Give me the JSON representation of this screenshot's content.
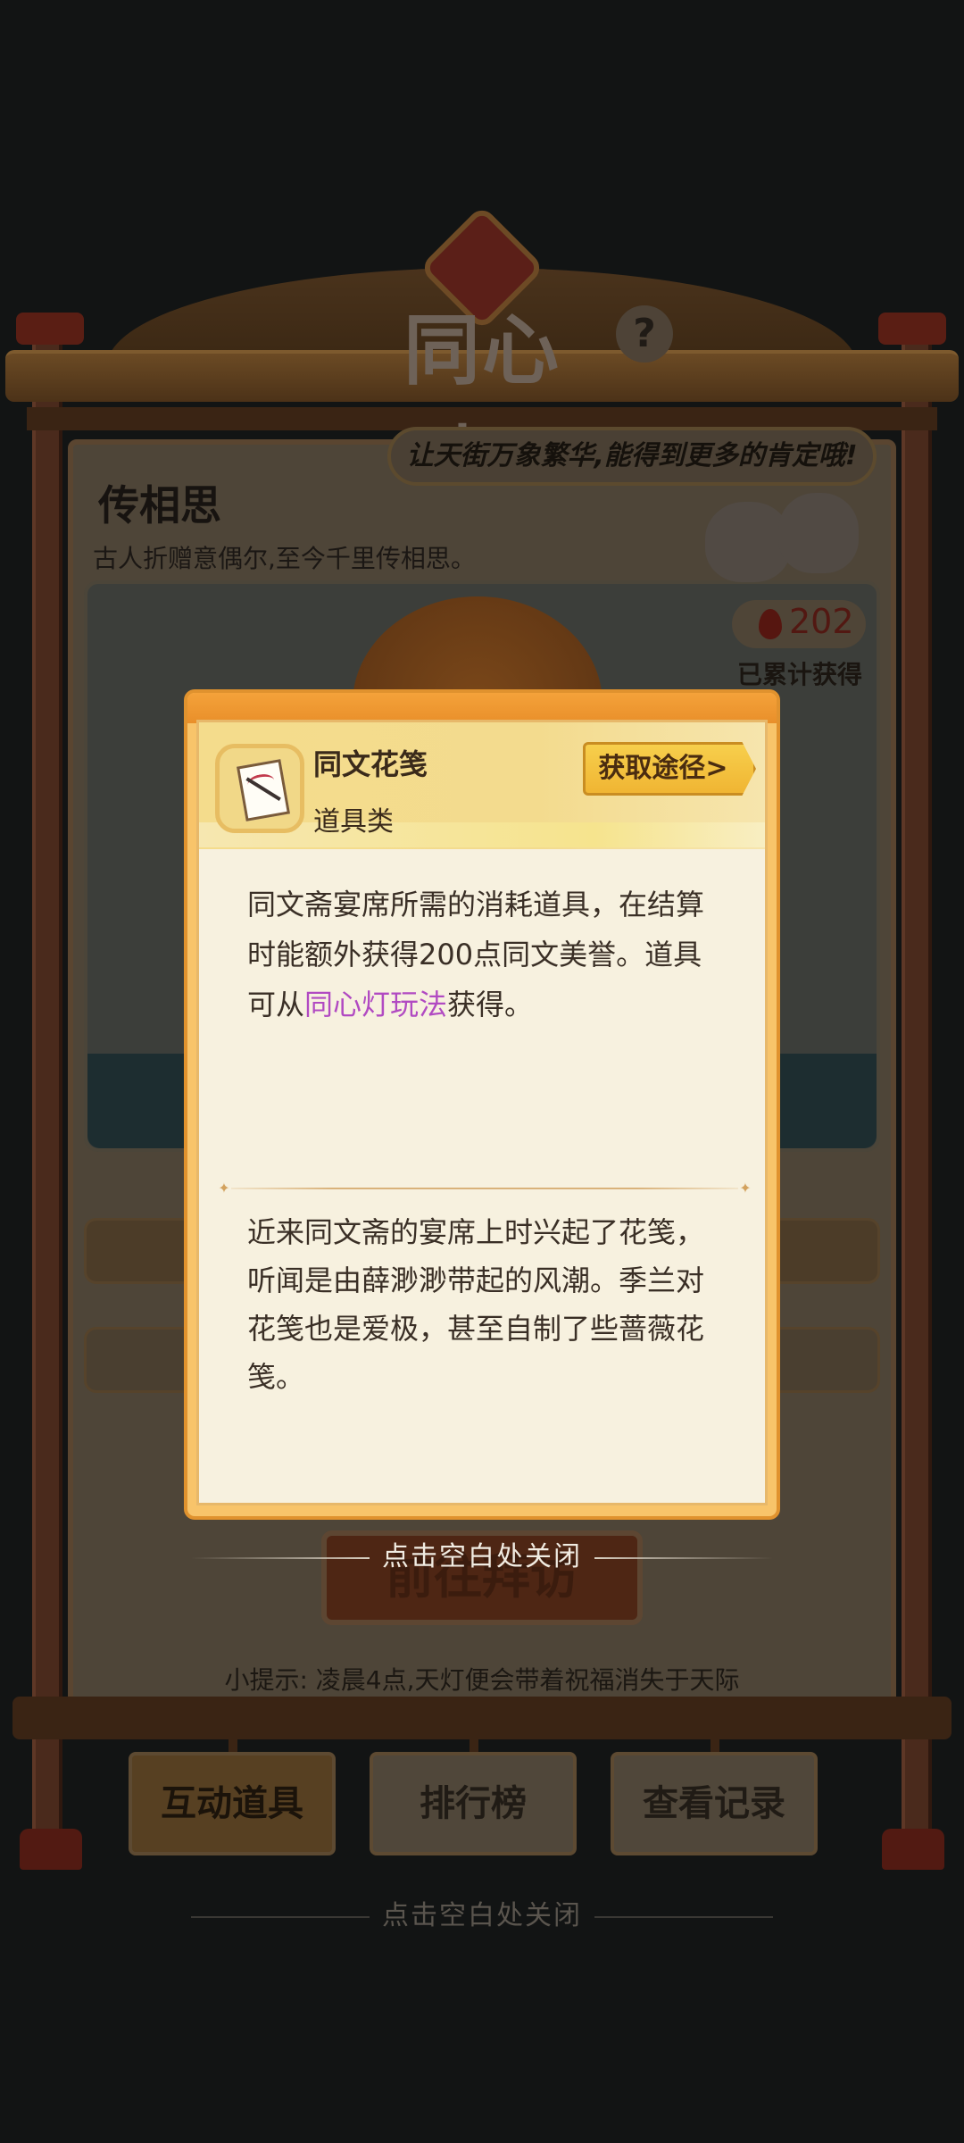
{
  "game": {
    "title": "同心灯",
    "help_icon": "question-icon",
    "banner_text": "让天街万象繁华,能得到更多的肯定哦!",
    "section_title": "传相思",
    "section_subtitle": "古人折赠意偶尔,至今千里传相思。",
    "counter": {
      "icon": "lantern-flame-icon",
      "value": "202",
      "label": "已累计获得"
    },
    "visit_button": "前往拜访",
    "tip": "小提示: 凌晨4点,天灯便会带着祝福消失于天际",
    "tabs": [
      {
        "label": "互动道具",
        "active": true
      },
      {
        "label": "排行榜",
        "active": false
      },
      {
        "label": "查看记录",
        "active": false
      }
    ],
    "bottom_close_hint": "点击空白处关闭"
  },
  "item_modal": {
    "icon": "flower-notepaper-icon",
    "name": "同文花笺",
    "type": "道具类",
    "obtain_button": "获取途径>",
    "description_pre": "同文斋宴席所需的消耗道具，在结算时能额外获得200点同文美誉。道具可从",
    "description_link": "同心灯玩法",
    "description_post": "获得。",
    "lore": "近来同文斋的宴席上时兴起了花笺，听闻是由薛渺渺带起的风潮。季兰对花笺也是爱极，甚至自制了些蔷薇花笺。",
    "close_hint": "点击空白处关闭"
  },
  "colors": {
    "accent_link": "#b14ac2",
    "modal_frame": "#e98f2a",
    "obtain_button": "#f3c13e",
    "overlay": "#121414"
  }
}
